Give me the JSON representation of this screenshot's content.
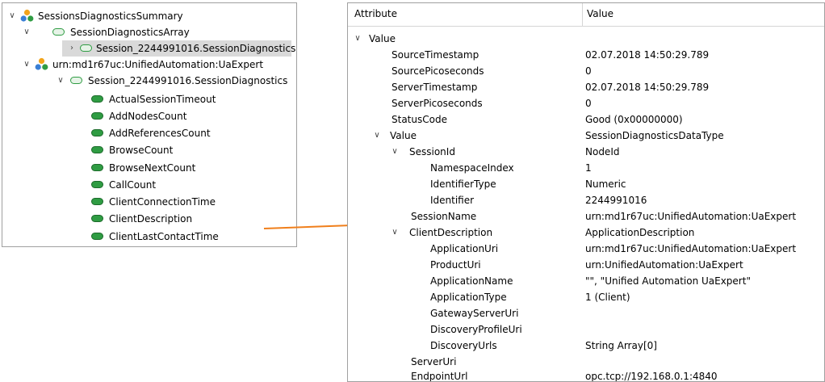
{
  "tree": {
    "nodes": [
      {
        "label": "SessionsDiagnosticsSummary",
        "chevron": "v",
        "icon": "object-icon"
      },
      {
        "label": "SessionDiagnosticsArray",
        "chevron": "v",
        "icon": "variable-icon"
      },
      {
        "label": "Session_2244991016.SessionDiagnostics",
        "chevron": ">",
        "icon": "variable-icon",
        "selected": true
      },
      {
        "label": "urn:md1r67uc:UnifiedAutomation:UaExpert",
        "chevron": "v",
        "icon": "object-icon"
      },
      {
        "label": "Session_2244991016.SessionDiagnostics",
        "chevron": "v",
        "icon": "variable-icon"
      },
      {
        "label": "ActualSessionTimeout",
        "icon": "variable-icon"
      },
      {
        "label": "AddNodesCount",
        "icon": "variable-icon"
      },
      {
        "label": "AddReferencesCount",
        "icon": "variable-icon"
      },
      {
        "label": "BrowseCount",
        "icon": "variable-icon"
      },
      {
        "label": "BrowseNextCount",
        "icon": "variable-icon"
      },
      {
        "label": "CallCount",
        "icon": "variable-icon"
      },
      {
        "label": "ClientConnectionTime",
        "icon": "variable-icon"
      },
      {
        "label": "ClientDescription",
        "icon": "variable-icon"
      },
      {
        "label": "ClientLastContactTime",
        "icon": "variable-icon"
      }
    ]
  },
  "attributes": {
    "header": {
      "attribute": "Attribute",
      "value": "Value"
    },
    "rows": [
      {
        "name": "Value",
        "value": "",
        "chevron": "v"
      },
      {
        "name": "SourceTimestamp",
        "value": "02.07.2018 14:50:29.789"
      },
      {
        "name": "SourcePicoseconds",
        "value": "0"
      },
      {
        "name": "ServerTimestamp",
        "value": "02.07.2018 14:50:29.789"
      },
      {
        "name": "ServerPicoseconds",
        "value": "0"
      },
      {
        "name": "StatusCode",
        "value": "Good (0x00000000)"
      },
      {
        "name": "Value",
        "value": "SessionDiagnosticsDataType",
        "chevron": "v"
      },
      {
        "name": "SessionId",
        "value": "NodeId",
        "chevron": "v"
      },
      {
        "name": "NamespaceIndex",
        "value": "1"
      },
      {
        "name": "IdentifierType",
        "value": "Numeric"
      },
      {
        "name": "Identifier",
        "value": "2244991016"
      },
      {
        "name": "SessionName",
        "value": "urn:md1r67uc:UnifiedAutomation:UaExpert"
      },
      {
        "name": "ClientDescription",
        "value": "ApplicationDescription",
        "chevron": "v"
      },
      {
        "name": "ApplicationUri",
        "value": "urn:md1r67uc:UnifiedAutomation:UaExpert"
      },
      {
        "name": "ProductUri",
        "value": "urn:UnifiedAutomation:UaExpert"
      },
      {
        "name": "ApplicationName",
        "value": "\"\", \"Unified Automation UaExpert\""
      },
      {
        "name": "ApplicationType",
        "value": "1 (Client)"
      },
      {
        "name": "GatewayServerUri",
        "value": ""
      },
      {
        "name": "DiscoveryProfileUri",
        "value": ""
      },
      {
        "name": "DiscoveryUrls",
        "value": "String Array[0]"
      },
      {
        "name": "ServerUri",
        "value": ""
      },
      {
        "name": "EndpointUrl",
        "value": "opc.tcp://192.168.0.1:4840"
      }
    ]
  },
  "colors": {
    "arrow": "#f07f1b",
    "node_green": "#2f9c43",
    "selection": "#d9d9d9"
  }
}
